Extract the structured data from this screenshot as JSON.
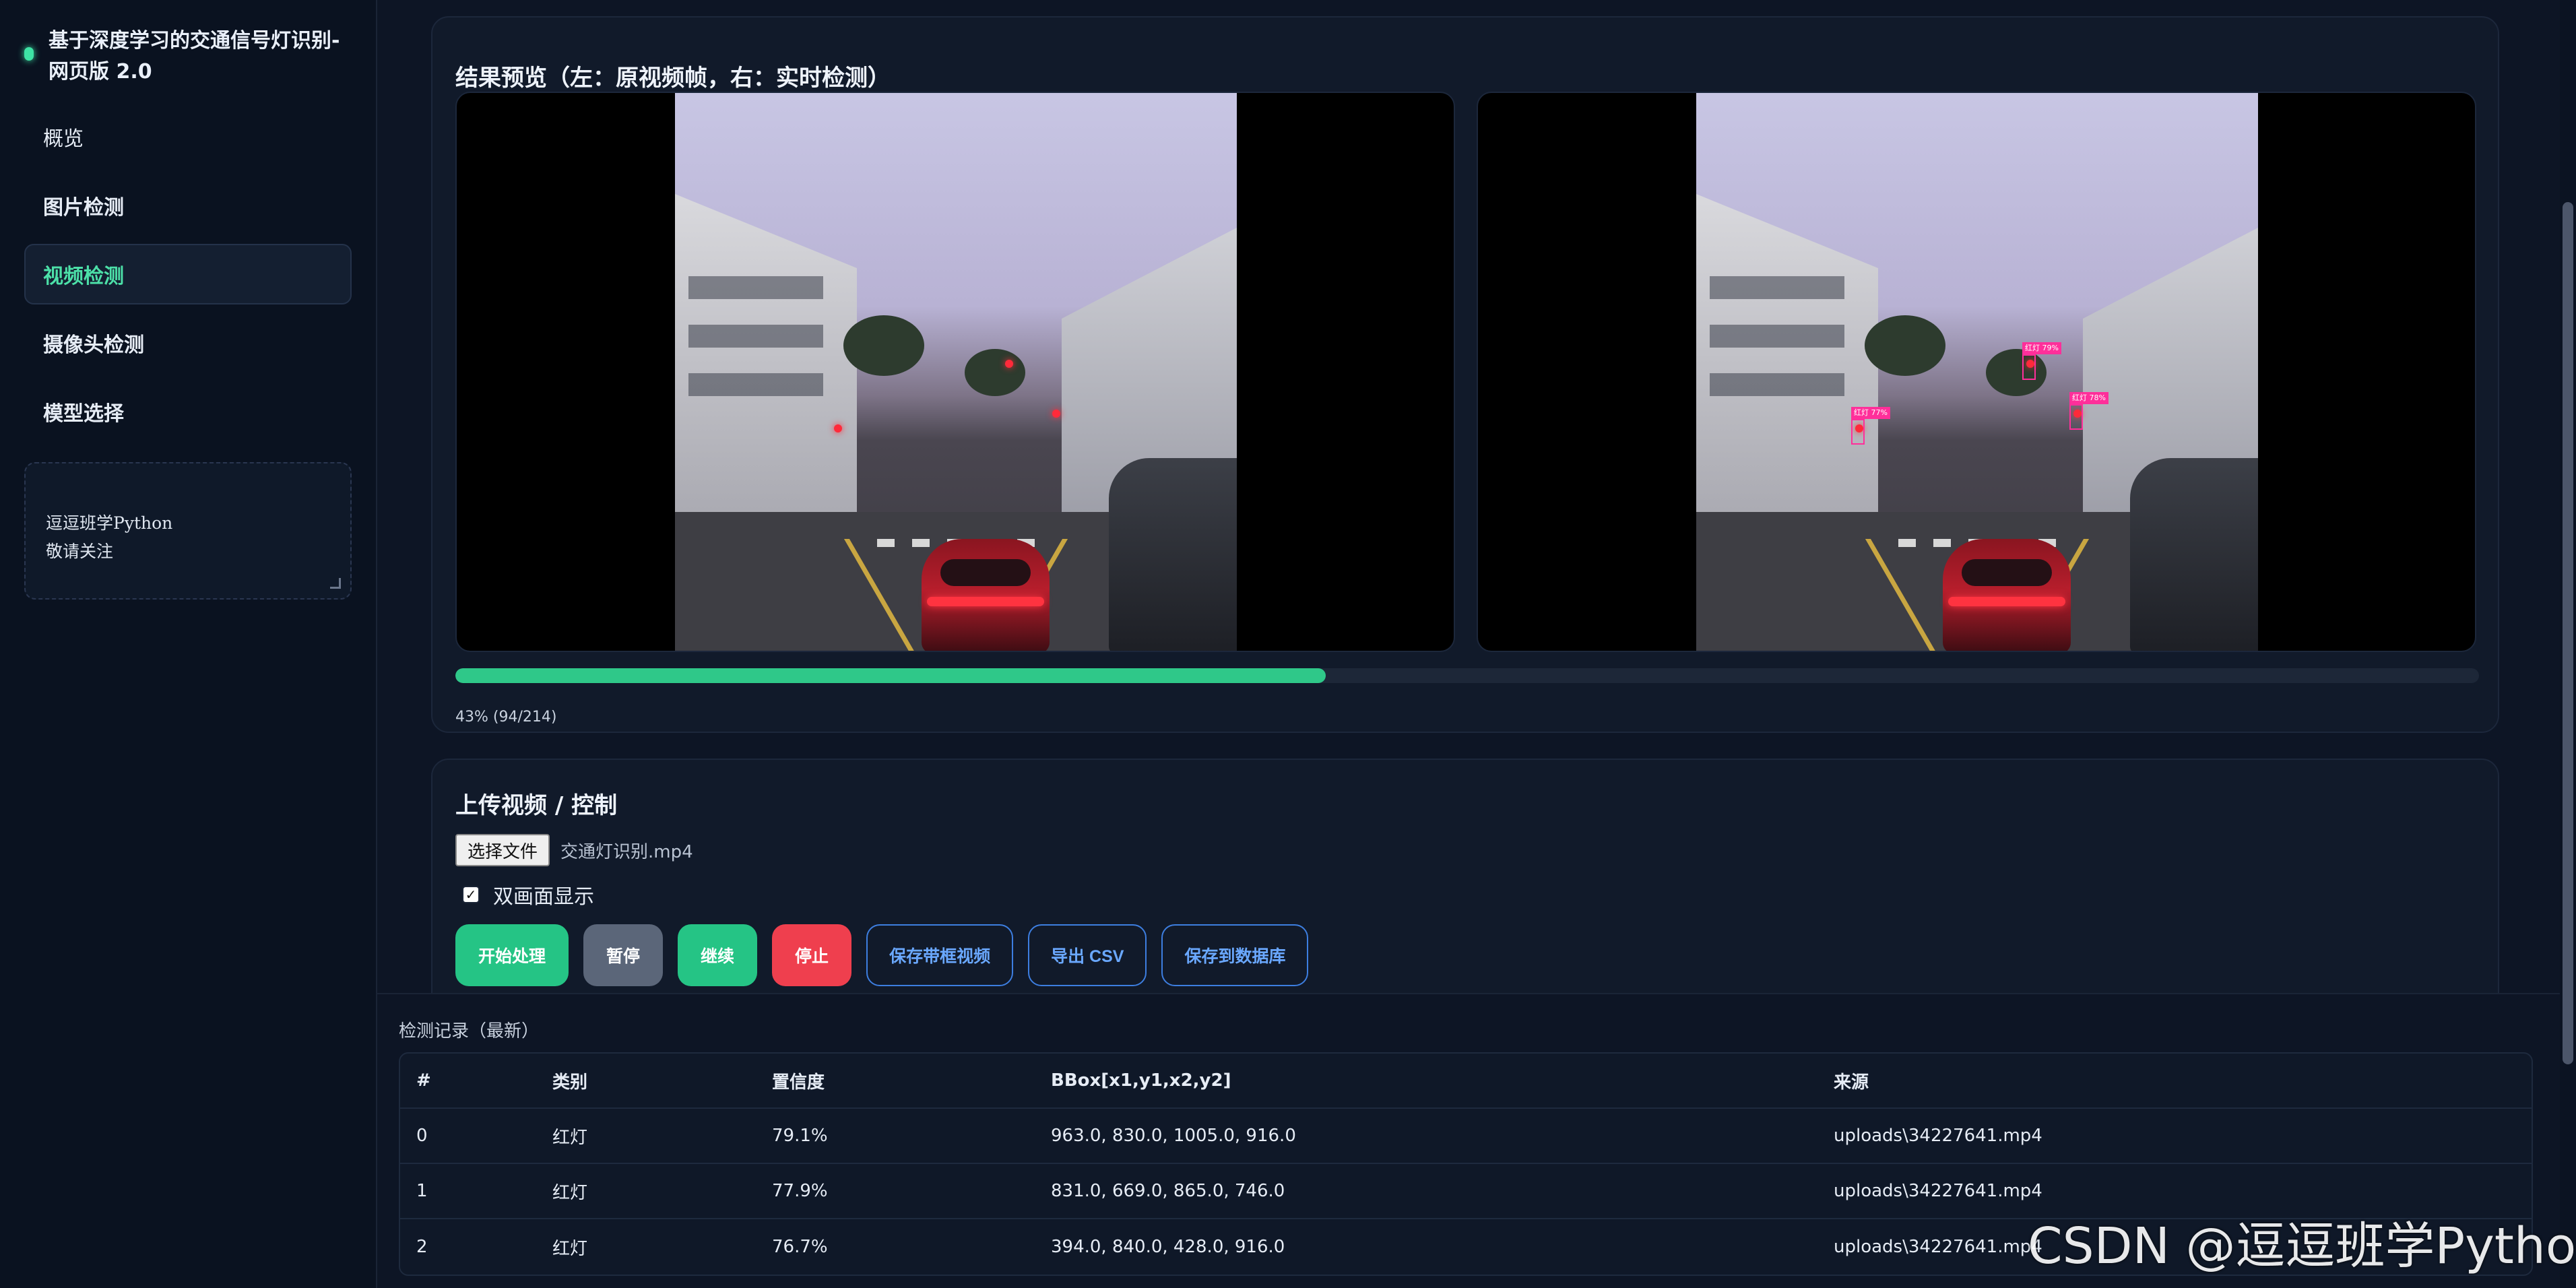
{
  "sidebar": {
    "brand_title": "基于深度学习的交通信号灯识别-网页版 2.0",
    "items": [
      {
        "label": "概览"
      },
      {
        "label": "图片检测"
      },
      {
        "label": "视频检测"
      },
      {
        "label": "摄像头检测"
      },
      {
        "label": "模型选择"
      }
    ],
    "active_index": 2,
    "note_text": "逗逗班学Python\n敬请关注"
  },
  "preview": {
    "title": "结果预览（左：原视频帧，右：实时检测）",
    "progress_fraction": 0.43,
    "progress_text": "43% (94/214)",
    "detections": [
      {
        "label": "红灯 79%"
      },
      {
        "label": "红灯 78%"
      },
      {
        "label": "红灯 77%"
      }
    ]
  },
  "upload": {
    "title": "上传视频 / 控制",
    "file_button": "选择文件",
    "file_name": "交通灯识别.mp4",
    "dual_view_label": "双画面显示",
    "dual_view_checked": true,
    "buttons": {
      "start": "开始处理",
      "pause": "暂停",
      "resume": "继续",
      "stop": "停止",
      "save_video": "保存带框视频",
      "export_csv": "导出 CSV",
      "save_db": "保存到数据库"
    }
  },
  "records": {
    "title": "检测记录（最新）",
    "columns": [
      "#",
      "类别",
      "置信度",
      "BBox[x1,y1,x2,y2]",
      "来源"
    ],
    "rows": [
      [
        "0",
        "红灯",
        "79.1%",
        "963.0, 830.0, 1005.0, 916.0",
        "uploads\\34227641.mp4"
      ],
      [
        "1",
        "红灯",
        "77.9%",
        "831.0, 669.0, 865.0, 746.0",
        "uploads\\34227641.mp4"
      ],
      [
        "2",
        "红灯",
        "76.7%",
        "394.0, 840.0, 428.0, 916.0",
        "uploads\\34227641.mp4"
      ]
    ]
  },
  "watermark": "CSDN @逗逗班学Python",
  "colors": {
    "accent": "#2fc889",
    "danger": "#ef3f4e",
    "outline": "#3d7ee0",
    "background": "#0d1525"
  }
}
